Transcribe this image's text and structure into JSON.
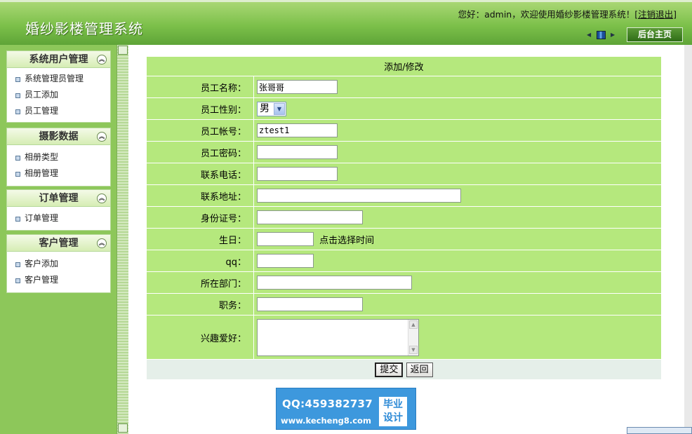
{
  "header": {
    "app_title": "婚纱影楼管理系统",
    "greeting_prefix": "您好：admin，欢迎使用婚纱影楼管理系统！",
    "logout_link": "[注销退出]",
    "home_button": "后台主页",
    "nav_prev_glyph": "◀",
    "nav_next_glyph": "▶"
  },
  "sidebar": {
    "collapse_glyph": "︽",
    "groups": [
      {
        "title": "系统用户管理",
        "items": [
          "系统管理员管理",
          "员工添加",
          "员工管理"
        ]
      },
      {
        "title": "摄影数据",
        "items": [
          "相册类型",
          "相册管理"
        ]
      },
      {
        "title": "订单管理",
        "items": [
          "订单管理"
        ]
      },
      {
        "title": "客户管理",
        "items": [
          "客户添加",
          "客户管理"
        ]
      }
    ]
  },
  "form": {
    "caption": "添加/修改",
    "fields": {
      "name": {
        "label": "员工名称：",
        "value": "张哥哥"
      },
      "gender": {
        "label": "员工性别：",
        "value": "男",
        "arrow": "▼"
      },
      "account": {
        "label": "员工帐号：",
        "value": "ztest1"
      },
      "password": {
        "label": "员工密码：",
        "value": ""
      },
      "phone": {
        "label": "联系电话：",
        "value": ""
      },
      "address": {
        "label": "联系地址：",
        "value": ""
      },
      "id_number": {
        "label": "身份证号：",
        "value": ""
      },
      "birthday": {
        "label": "生日：",
        "value": "",
        "hint": "点击选择时间"
      },
      "qq": {
        "label": "qq：",
        "value": ""
      },
      "department": {
        "label": "所在部门：",
        "value": ""
      },
      "position": {
        "label": "职务：",
        "value": ""
      },
      "hobbies": {
        "label": "兴趣爱好：",
        "value": "",
        "scroll_up": "▲",
        "scroll_down": "▼"
      }
    },
    "submit_label": "提交",
    "back_label": "返回"
  },
  "watermark": {
    "qq_text": "QQ:459382737",
    "url_text": "www.kecheng8.com",
    "badge_line1": "毕业",
    "badge_line2": "设计"
  },
  "colors": {
    "header_green": "#7cc04a",
    "sidebar_green": "#8dc75a",
    "form_row_green": "#b5e87d",
    "button_row": "#e5efe9",
    "watermark_blue": "#3d98dd"
  }
}
